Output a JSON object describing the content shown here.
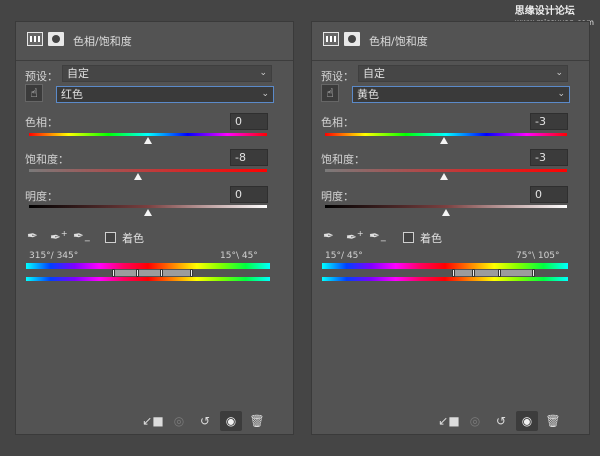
{
  "watermark": {
    "text": "思缘设计论坛",
    "url": "www.missvuan.com"
  },
  "panels": [
    {
      "title": "色相/饱和度",
      "preset_label": "预设：",
      "preset_value": "自定",
      "channel_value": "红色",
      "hue_label": "色相：",
      "hue_value": "0",
      "sat_label": "饱和度：",
      "sat_value": "-8",
      "light_label": "明度：",
      "light_value": "0",
      "colorize_label": "着色",
      "range_left": "315°/ 345°",
      "range_right": "15°\\ 45°",
      "hue_level": 0.5,
      "sat_level": 0.46,
      "light_level": 0.5
    },
    {
      "title": "色相/饱和度",
      "preset_label": "预设：",
      "preset_value": "自定",
      "channel_value": "黄色",
      "hue_label": "色相：",
      "hue_value": "-3",
      "sat_label": "饱和度：",
      "sat_value": "-3",
      "light_label": "明度：",
      "light_value": "0",
      "colorize_label": "着色",
      "range_left": "15°/ 45°",
      "range_right": "75°\\ 105°",
      "hue_level": 0.49,
      "sat_level": 0.49,
      "light_level": 0.5
    }
  ],
  "colors": {
    "panel_bg": "#535353",
    "active_border": "#5b8ac9"
  },
  "icons": [
    "adjustment-icon",
    "mask-icon",
    "hand-icon",
    "eyedropper-icon",
    "eyedropper-plus-icon",
    "eyedropper-minus-icon",
    "clip-icon",
    "view-previous-icon",
    "reset-icon",
    "visibility-icon",
    "trash-icon"
  ]
}
